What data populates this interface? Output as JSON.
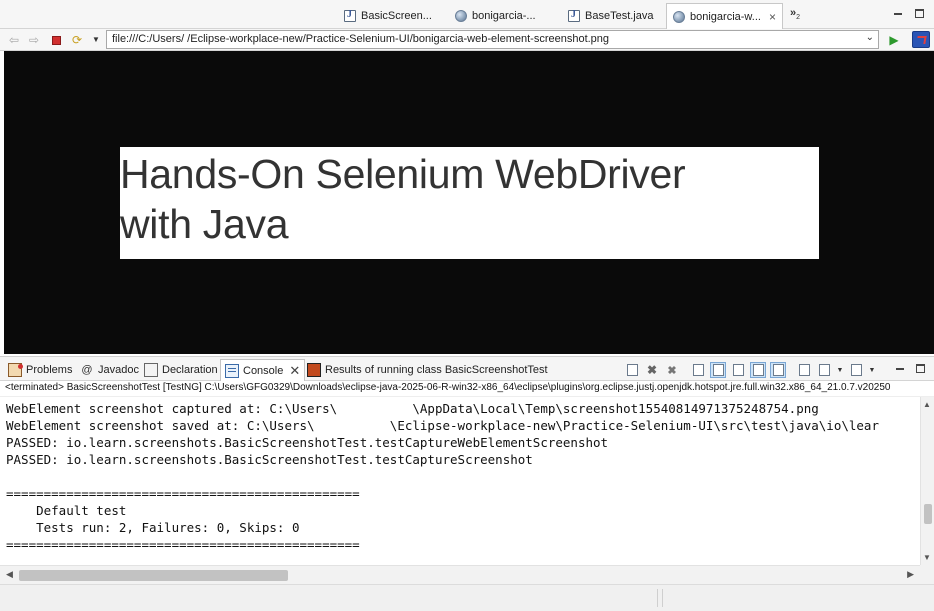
{
  "editor_tabs": [
    {
      "label": "BasicScreen...",
      "icon": "java-file-icon",
      "active": false
    },
    {
      "label": "bonigarcia-...",
      "icon": "globe-icon",
      "active": false
    },
    {
      "label": "BaseTest.java",
      "icon": "java-file-icon",
      "active": false
    },
    {
      "label": "bonigarcia-w...",
      "icon": "globe-icon",
      "active": true
    }
  ],
  "editor_tab_close": "×",
  "overflow": {
    "chevron": "»",
    "count": "2"
  },
  "toolbar": {
    "back_glyph": "⇦",
    "forward_glyph": "⇨",
    "url": "file:///C:/Users/          /Eclipse-workplace-new/Practice-Selenium-UI/bonigarcia-web-element-screenshot.png",
    "go_glyph": "▶"
  },
  "browser_view": {
    "background_color": "#0a0a0a",
    "screenshot_line1": "Hands-On Selenium WebDriver",
    "screenshot_line2": "with Java"
  },
  "view_tabs": [
    {
      "label": "Problems",
      "icon": "problems-icon",
      "active": false
    },
    {
      "label": "Javadoc",
      "icon": "at-sign-icon",
      "active": false
    },
    {
      "label": "Declaration",
      "icon": "declaration-icon",
      "active": false
    },
    {
      "label": "Console",
      "icon": "console-icon",
      "active": true
    },
    {
      "label": "Results of running class BasicScreenshotTest",
      "icon": "testng-icon",
      "active": false
    }
  ],
  "view_tab_close": "✕",
  "status_line": "<terminated> BasicScreenshotTest [TestNG] C:\\Users\\GFG0329\\Downloads\\eclipse-java-2025-06-R-win32-x86_64\\eclipse\\plugins\\org.eclipse.justj.openjdk.hotspot.jre.full.win32.x86_64_21.0.7.v20250",
  "console": {
    "lines": [
      "WebElement screenshot captured at: C:\\Users\\          \\AppData\\Local\\Temp\\screenshot15540814971375248754.png",
      "WebElement screenshot saved at: C:\\Users\\          \\Eclipse-workplace-new\\Practice-Selenium-UI\\src\\test\\java\\io\\lear",
      "PASSED: io.learn.screenshots.BasicScreenshotTest.testCaptureWebElementScreenshot",
      "PASSED: io.learn.screenshots.BasicScreenshotTest.testCaptureScreenshot",
      "",
      "===============================================",
      "    Default test",
      "    Tests run: 2, Failures: 0, Skips: 0",
      "==============================================="
    ]
  },
  "colors": {
    "accent": "#2b55b5",
    "stop_red": "#d12f2f",
    "go_green": "#2e9a2e",
    "pressed_blue": "#cde3f7"
  }
}
